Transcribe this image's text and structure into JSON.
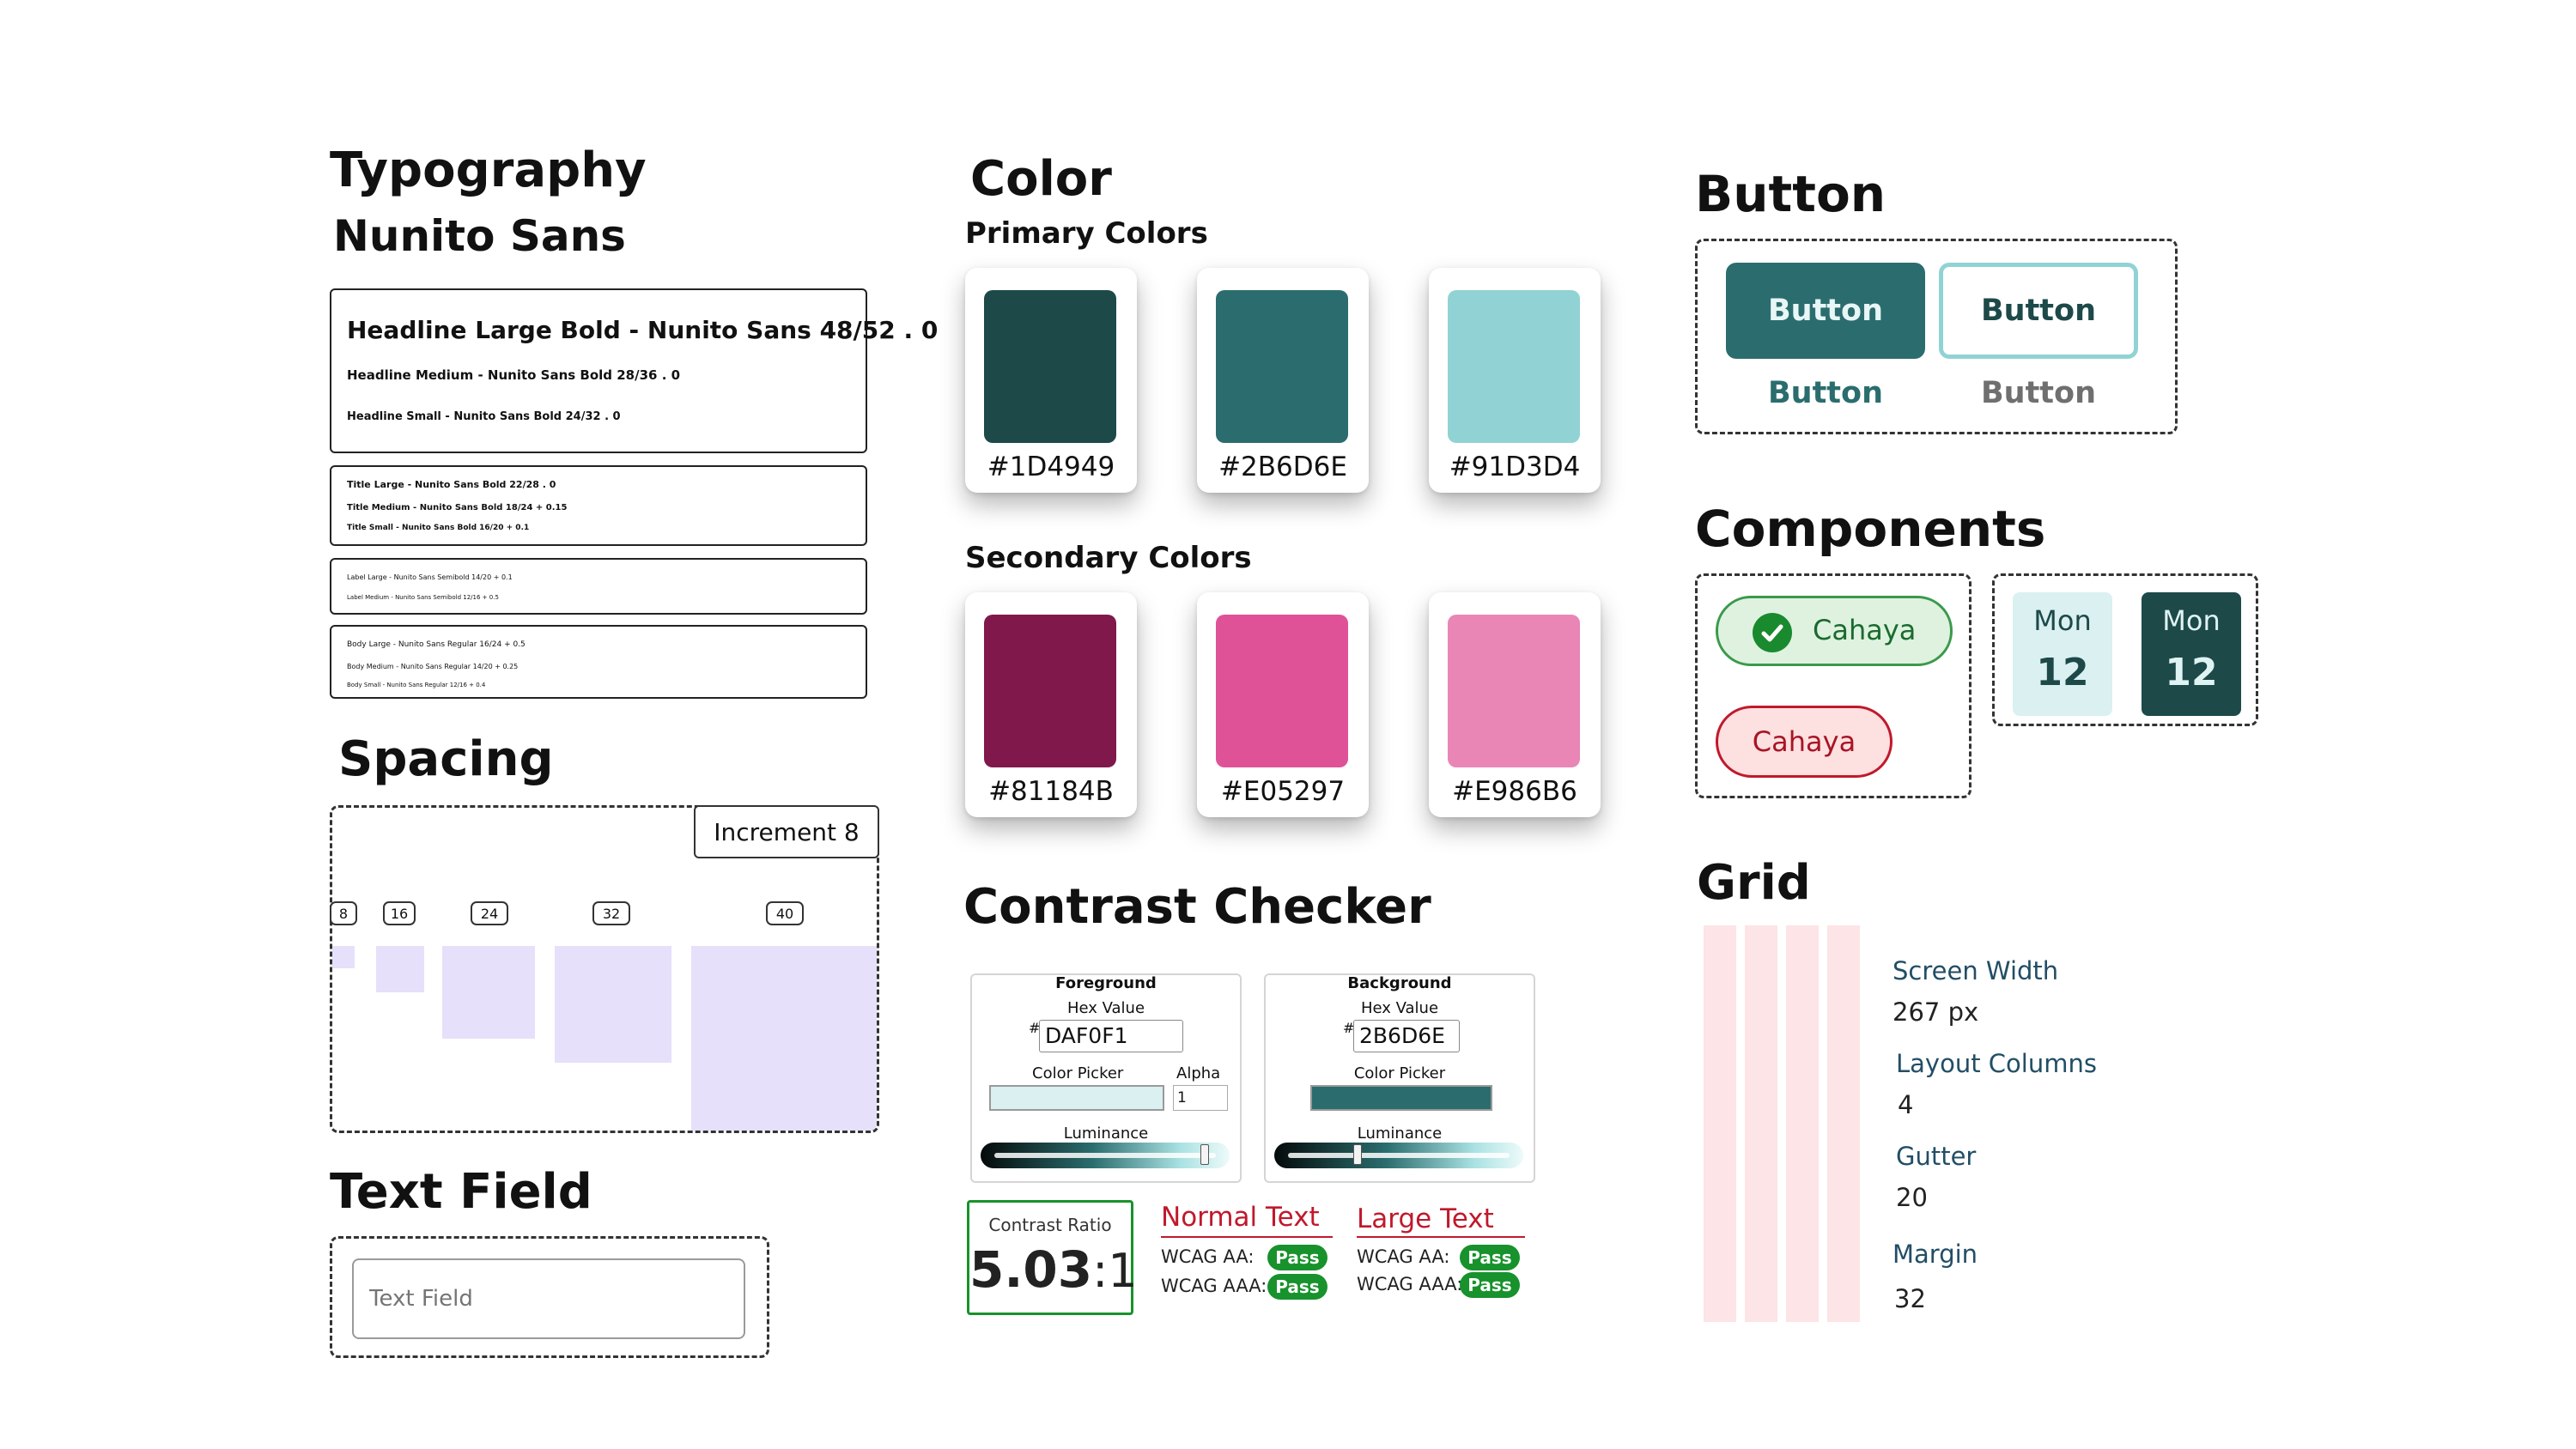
{
  "typography": {
    "title": "Typography",
    "font_name": "Nunito Sans",
    "headlines": [
      "Headline Large Bold - Nunito Sans 48/52 . 0",
      "Headline Medium - Nunito Sans Bold 28/36 . 0",
      "Headline Small - Nunito Sans Bold 24/32 . 0"
    ],
    "titles": [
      "Title Large - Nunito Sans Bold 22/28 . 0",
      "Title Medium - Nunito Sans Bold 18/24 + 0.15",
      "Title Small - Nunito Sans Bold 16/20 + 0.1"
    ],
    "labels": [
      "Label Large - Nunito Sans Semibold 14/20 + 0.1",
      "Label Medium - Nunito Sans Semibold 12/16 + 0.5"
    ],
    "bodies": [
      "Body Large - Nunito Sans Regular 16/24 + 0.5",
      "Body Medium - Nunito Sans Regular 14/20 + 0.25",
      "Body Small - Nunito Sans Regular 12/16 + 0.4"
    ]
  },
  "spacing": {
    "title": "Spacing",
    "increment_label": "Increment 8",
    "steps": [
      "8",
      "16",
      "24",
      "32",
      "40"
    ]
  },
  "text_field": {
    "title": "Text Field",
    "placeholder": "Text Field"
  },
  "color": {
    "title": "Color",
    "primary_title": "Primary Colors",
    "primary": [
      {
        "hex": "#1D4949",
        "color": "#1D4949"
      },
      {
        "hex": "#2B6D6E",
        "color": "#2B6D6E"
      },
      {
        "hex": "#91D3D4",
        "color": "#91D3D4"
      }
    ],
    "secondary_title": "Secondary Colors",
    "secondary": [
      {
        "hex": "#81184B",
        "color": "#81184B"
      },
      {
        "hex": "#E05297",
        "color": "#E05297"
      },
      {
        "hex": "#E986B6",
        "color": "#E986B6"
      }
    ]
  },
  "contrast": {
    "title": "Contrast Checker",
    "foreground": {
      "title": "Foreground",
      "hex_label": "Hex Value",
      "hash": "#",
      "hex": "DAF0F1",
      "picker_label": "Color Picker",
      "alpha_label": "Alpha",
      "alpha": "1",
      "luminance_label": "Luminance",
      "swatch": "#DAF0F1",
      "luminance": 0.9
    },
    "background": {
      "title": "Background",
      "hex_label": "Hex Value",
      "hash": "#",
      "hex": "2B6D6E",
      "picker_label": "Color Picker",
      "luminance_label": "Luminance",
      "swatch": "#2B6D6E",
      "luminance": 0.35
    },
    "ratio_label": "Contrast Ratio",
    "ratio_main": "5.03",
    "ratio_suffix": ":1",
    "normal_text": {
      "title": "Normal Text",
      "aa_label": "WCAG AA:",
      "aa": "Pass",
      "aaa_label": "WCAG AAA:",
      "aaa": "Pass"
    },
    "large_text": {
      "title": "Large Text",
      "aa_label": "WCAG AA:",
      "aa": "Pass",
      "aaa_label": "WCAG AAA:",
      "aaa": "Pass"
    }
  },
  "button": {
    "title": "Button",
    "filled": "Button",
    "outlined": "Button",
    "text": "Button",
    "text_disabled": "Button"
  },
  "components": {
    "title": "Components",
    "chip_selected": "Cahaya",
    "chip_error": "Cahaya",
    "date_light": {
      "day": "Mon",
      "date": "12"
    },
    "date_dark": {
      "day": "Mon",
      "date": "12"
    }
  },
  "grid": {
    "title": "Grid",
    "screen_width_label": "Screen Width",
    "screen_width": "267 px",
    "columns_label": "Layout Columns",
    "columns": "4",
    "gutter_label": "Gutter",
    "gutter": "20",
    "margin_label": "Margin",
    "margin": "32"
  },
  "colors": {
    "primary_dark": "#1D4949",
    "primary": "#2B6D6E",
    "primary_light": "#91D3D4",
    "pass_green": "#18922C",
    "error_red": "#C0192C",
    "spacing_fill": "#E6E0FB",
    "grid_fill": "#FDE4E6"
  }
}
